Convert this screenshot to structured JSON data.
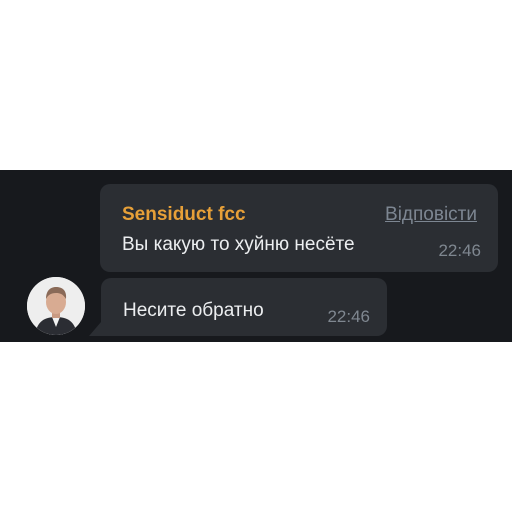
{
  "messages": [
    {
      "sender": "Sensiduct fcc",
      "reply_label": "Відповісти",
      "text": "Вы какую то хуйню несёте",
      "time": "22:46"
    },
    {
      "text": "Несите обратно",
      "time": "22:46"
    }
  ],
  "colors": {
    "background": "#17191d",
    "bubble": "#2b2e33",
    "sender_name": "#e7a038",
    "muted": "#7f8790",
    "text": "#eceef0"
  }
}
